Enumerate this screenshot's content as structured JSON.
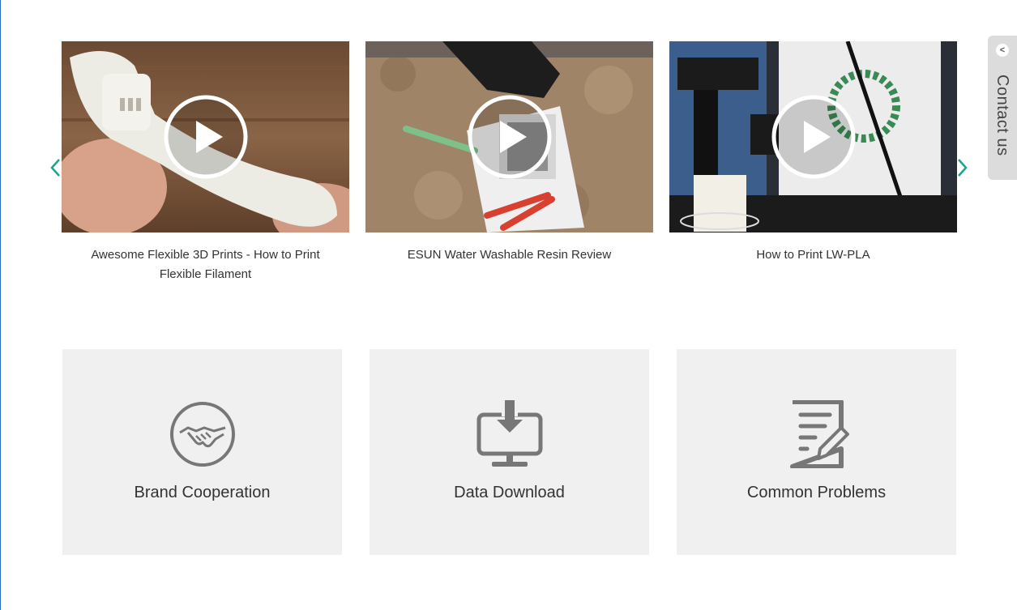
{
  "carousel": {
    "videos": [
      {
        "title": "Awesome Flexible 3D Prints - How to Print Flexible Filament"
      },
      {
        "title": "ESUN Water Washable Resin Review"
      },
      {
        "title": "How to Print LW-PLA"
      }
    ],
    "prev_icon": "chevron-left-icon",
    "next_icon": "chevron-right-icon",
    "arrow_color": "#1aa58a"
  },
  "tiles": [
    {
      "label": "Brand Cooperation",
      "icon": "handshake-icon"
    },
    {
      "label": "Data Download",
      "icon": "download-monitor-icon"
    },
    {
      "label": "Common Problems",
      "icon": "document-edit-icon"
    }
  ],
  "contact": {
    "label": "Contact us",
    "collapse_glyph": "<"
  },
  "colors": {
    "tile_bg": "#f0f0f0",
    "icon_gray": "#777777",
    "accent": "#1aa58a"
  }
}
